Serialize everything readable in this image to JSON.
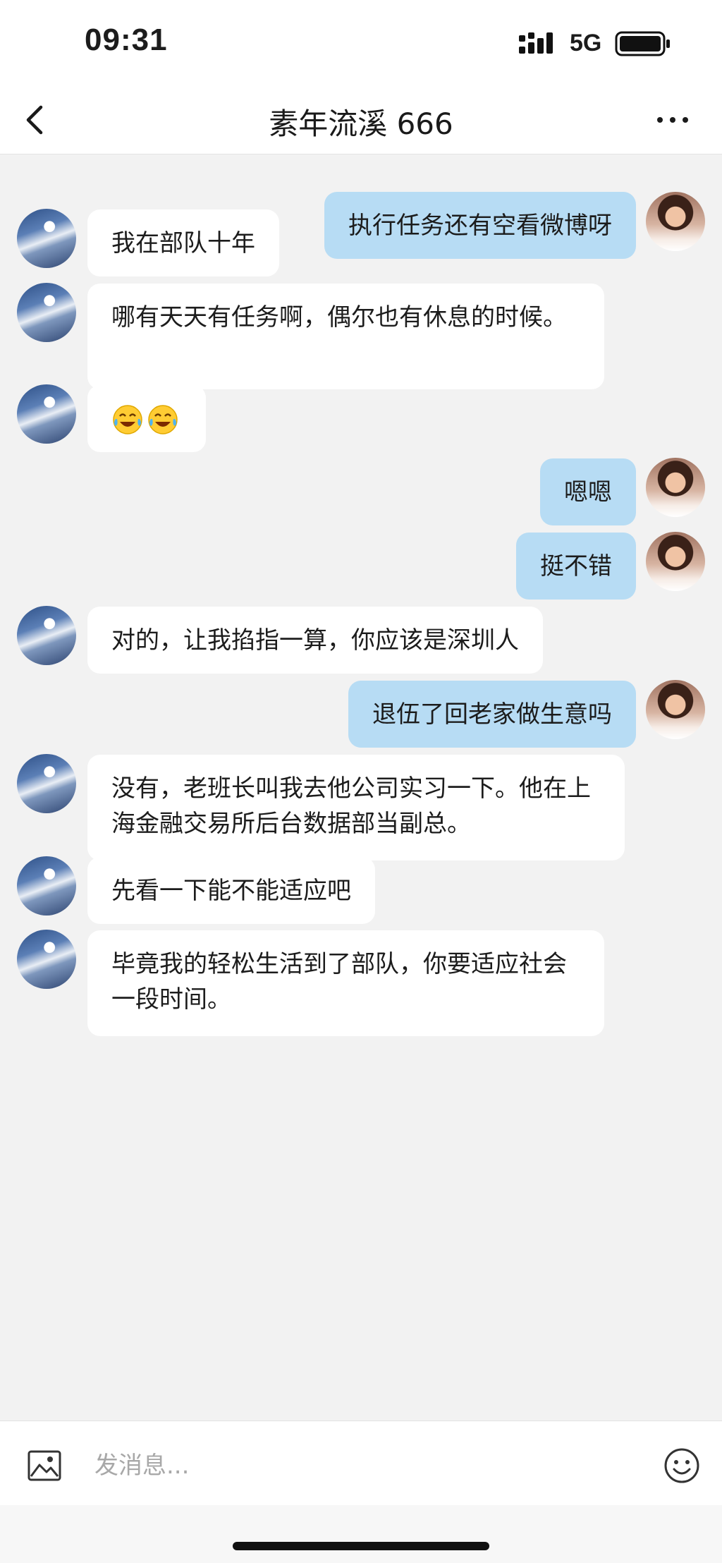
{
  "status_bar": {
    "time": "09:31",
    "network": "5G",
    "signal_icon": "signal-bars-icon",
    "battery_icon": "battery-icon"
  },
  "header": {
    "title": "素年流溪 666",
    "back_icon": "chevron-left-icon",
    "more_icon": "more-dots-icon"
  },
  "messages": [
    {
      "side": "sent",
      "text": "执行任务还有空看微博呀"
    },
    {
      "side": "received",
      "text": "我在部队十年"
    },
    {
      "side": "received",
      "text": "哪有天天有任务啊，偶尔也有休息的时候。"
    },
    {
      "side": "received",
      "emoji": [
        "laughing-crying-emoji",
        "laughing-crying-emoji"
      ]
    },
    {
      "side": "sent",
      "text": "嗯嗯"
    },
    {
      "side": "sent",
      "text": "挺不错"
    },
    {
      "side": "received",
      "text": "对的，让我掐指一算，你应该是深圳人"
    },
    {
      "side": "sent",
      "text": "退伍了回老家做生意吗"
    },
    {
      "side": "received",
      "text": "没有，老班长叫我去他公司实习一下。他在上海金融交易所后台数据部当副总。"
    },
    {
      "side": "received",
      "text": "先看一下能不能适应吧"
    },
    {
      "side": "received",
      "text": "毕竟我的轻松生活到了部队，你要适应社会一段时间。"
    }
  ],
  "input_bar": {
    "placeholder": "发消息...",
    "value": "",
    "image_icon": "image-icon",
    "emoji_icon": "smiley-icon"
  },
  "colors": {
    "sent_bubble": "#b7dcf4",
    "received_bubble": "#ffffff",
    "background": "#f2f2f2"
  }
}
